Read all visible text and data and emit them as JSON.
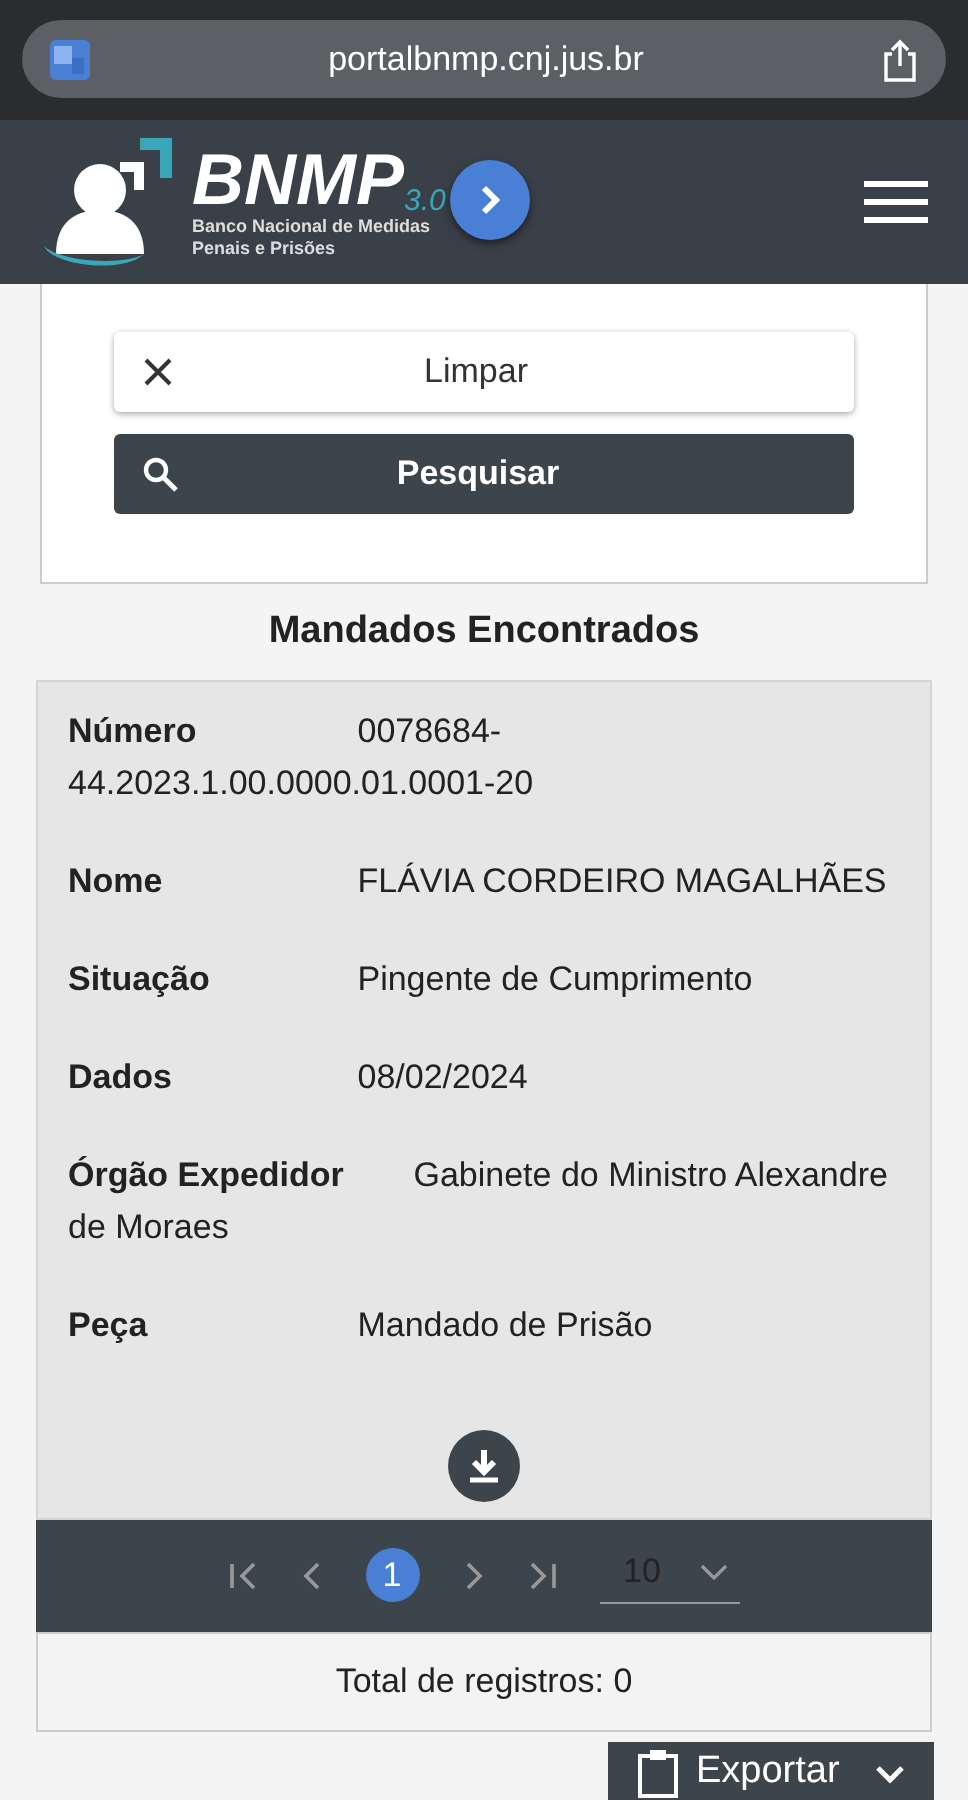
{
  "browser": {
    "url": "portalbnmp.cnj.jus.br"
  },
  "header": {
    "logo_title": "BNMP",
    "logo_version": "3.0",
    "logo_subtitle": "Banco Nacional de Medidas Penais e Prisões"
  },
  "filters": {
    "clear_button": "Limpar",
    "search_button": "Pesquisar"
  },
  "results": {
    "title": "Mandados Encontrados",
    "fields": [
      {
        "label": "Número",
        "value": "0078684-44.2023.1.00.0000.01.0001-20"
      },
      {
        "label": "Nome",
        "value": "FLÁVIA CORDEIRO MAGALHÃES"
      },
      {
        "label": "Situação",
        "value": "Pingente de Cumprimento"
      },
      {
        "label": "Dados",
        "value": "08/02/2024"
      },
      {
        "label": "Órgão Expedidor",
        "value": "Gabinete do Ministro Alexandre de Moraes"
      },
      {
        "label": "Peça",
        "value": "Mandado de Prisão"
      }
    ]
  },
  "pagination": {
    "pages": [
      {
        "label": "1",
        "selected": true
      }
    ],
    "page_size": "10"
  },
  "total": "Total de registros: 0",
  "export_button": "Exportar"
}
